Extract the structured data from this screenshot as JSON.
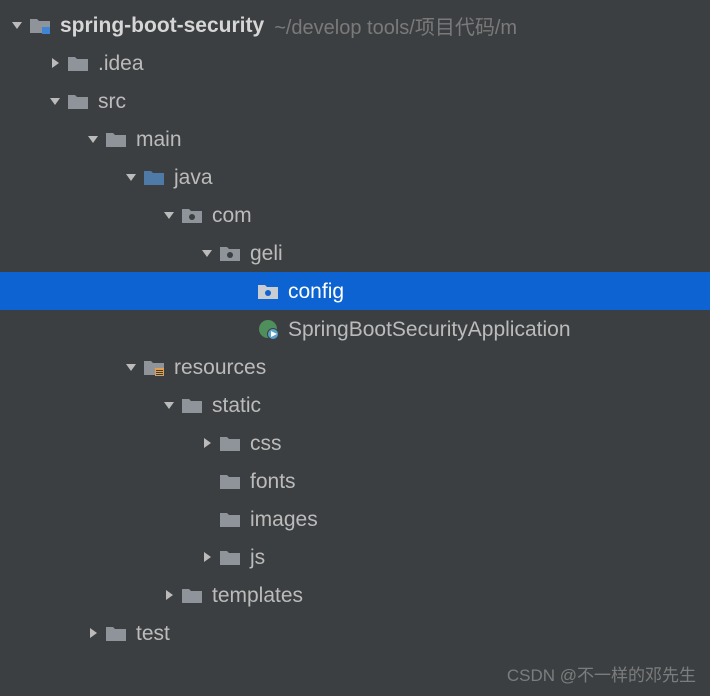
{
  "root": {
    "name": "spring-boot-security",
    "path": "~/develop tools/项目代码/m"
  },
  "nodes": {
    "idea": ".idea",
    "src": "src",
    "main": "main",
    "java": "java",
    "com": "com",
    "geli": "geli",
    "config": "config",
    "app": "SpringBootSecurityApplication",
    "resources": "resources",
    "static": "static",
    "css": "css",
    "fonts": "fonts",
    "images": "images",
    "js": "js",
    "templates": "templates",
    "test": "test"
  },
  "watermark": "CSDN @不一样的邓先生",
  "colors": {
    "folder_gray": "#9aa0a6",
    "folder_blue": "#5a9bd4",
    "selection": "#0d63d1",
    "module_badge": "#3e86d4",
    "resources_badge": "#e0a050"
  }
}
